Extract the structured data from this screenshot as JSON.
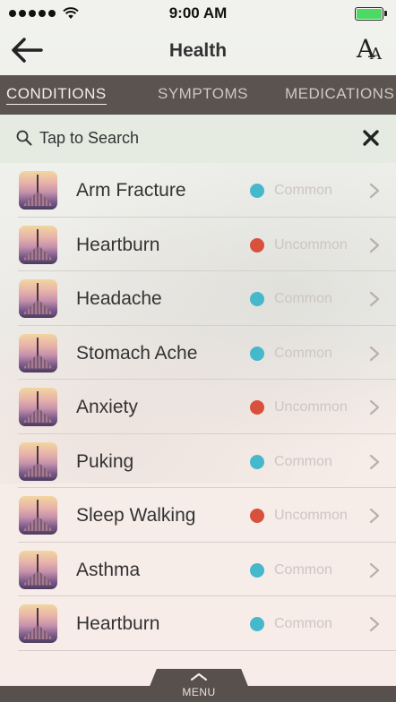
{
  "status_bar": {
    "time": "9:00 AM",
    "signal_dots": 5,
    "battery_level": 1.0,
    "battery_color": "#4cd964"
  },
  "header": {
    "title": "Health",
    "back_icon": "arrow-left-icon",
    "font_size_icon": "font-size-icon",
    "font_size_big": "A",
    "font_size_small": "A"
  },
  "tabs": [
    {
      "label": "Conditions",
      "active": true
    },
    {
      "label": "Symptoms",
      "active": false
    },
    {
      "label": "Medications",
      "active": false
    }
  ],
  "search": {
    "placeholder": "Tap to Search",
    "icon": "search-icon",
    "clear_icon": "close-icon"
  },
  "colors": {
    "common": "#45b8cc",
    "uncommon": "#d9513d",
    "tab_bar": "#5a5350",
    "search_bg": "#e5ebe0"
  },
  "conditions": [
    {
      "name": "Arm Fracture",
      "frequency": "Common"
    },
    {
      "name": "Heartburn",
      "frequency": "Uncommon"
    },
    {
      "name": "Headache",
      "frequency": "Common"
    },
    {
      "name": "Stomach Ache",
      "frequency": "Common"
    },
    {
      "name": "Anxiety",
      "frequency": "Uncommon"
    },
    {
      "name": "Puking",
      "frequency": "Common"
    },
    {
      "name": "Sleep Walking",
      "frequency": "Uncommon"
    },
    {
      "name": "Asthma",
      "frequency": "Common"
    },
    {
      "name": "Heartburn",
      "frequency": "Common"
    }
  ],
  "bottom": {
    "menu_label": "MENU",
    "menu_icon": "chevron-up-icon"
  }
}
